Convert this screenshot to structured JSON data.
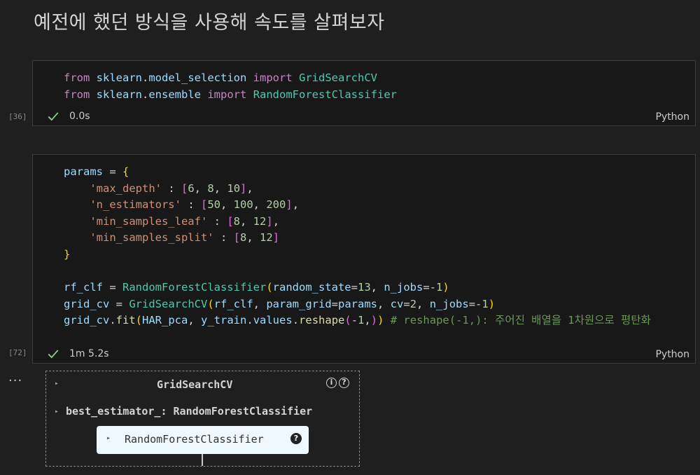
{
  "markdown": {
    "heading": "예전에 했던 방식을 사용해 속도를 살펴보자"
  },
  "cells": [
    {
      "exec_count": "[36]",
      "status_time": "0.0s",
      "language": "Python",
      "lines": [
        [
          [
            "kw",
            "from"
          ],
          [
            "op",
            " "
          ],
          [
            "var",
            "sklearn"
          ],
          [
            "op",
            "."
          ],
          [
            "var",
            "model_selection"
          ],
          [
            "op",
            " "
          ],
          [
            "kw",
            "import"
          ],
          [
            "op",
            " "
          ],
          [
            "cls",
            "GridSearchCV"
          ]
        ],
        [
          [
            "kw",
            "from"
          ],
          [
            "op",
            " "
          ],
          [
            "var",
            "sklearn"
          ],
          [
            "op",
            "."
          ],
          [
            "var",
            "ensemble"
          ],
          [
            "op",
            " "
          ],
          [
            "kw",
            "import"
          ],
          [
            "op",
            " "
          ],
          [
            "cls",
            "RandomForestClassifier"
          ]
        ]
      ]
    },
    {
      "exec_count": "[72]",
      "status_time": "1m 5.2s",
      "language": "Python",
      "lines": [
        [
          [
            "var",
            "params"
          ],
          [
            "op",
            " = "
          ],
          [
            "br1",
            "{"
          ]
        ],
        [
          [
            "op",
            "    "
          ],
          [
            "str",
            "'max_depth'"
          ],
          [
            "op",
            " : "
          ],
          [
            "br2",
            "["
          ],
          [
            "num",
            "6"
          ],
          [
            "op",
            ", "
          ],
          [
            "num",
            "8"
          ],
          [
            "op",
            ", "
          ],
          [
            "num",
            "10"
          ],
          [
            "br2",
            "]"
          ],
          [
            "op",
            ","
          ]
        ],
        [
          [
            "op",
            "    "
          ],
          [
            "str",
            "'n_estimators'"
          ],
          [
            "op",
            " : "
          ],
          [
            "br2",
            "["
          ],
          [
            "num",
            "50"
          ],
          [
            "op",
            ", "
          ],
          [
            "num",
            "100"
          ],
          [
            "op",
            ", "
          ],
          [
            "num",
            "200"
          ],
          [
            "br2",
            "]"
          ],
          [
            "op",
            ","
          ]
        ],
        [
          [
            "op",
            "    "
          ],
          [
            "str",
            "'min_samples_leaf'"
          ],
          [
            "op",
            " : "
          ],
          [
            "br2",
            "["
          ],
          [
            "num",
            "8"
          ],
          [
            "op",
            ", "
          ],
          [
            "num",
            "12"
          ],
          [
            "br2",
            "]"
          ],
          [
            "op",
            ","
          ]
        ],
        [
          [
            "op",
            "    "
          ],
          [
            "str",
            "'min_samples_split'"
          ],
          [
            "op",
            " : "
          ],
          [
            "br2",
            "["
          ],
          [
            "num",
            "8"
          ],
          [
            "op",
            ", "
          ],
          [
            "num",
            "12"
          ],
          [
            "br2",
            "]"
          ]
        ],
        [
          [
            "br1",
            "}"
          ]
        ],
        [
          [
            "op",
            ""
          ]
        ],
        [
          [
            "var",
            "rf_clf"
          ],
          [
            "op",
            " = "
          ],
          [
            "cls",
            "RandomForestClassifier"
          ],
          [
            "br1",
            "("
          ],
          [
            "var",
            "random_state"
          ],
          [
            "op",
            "="
          ],
          [
            "num",
            "13"
          ],
          [
            "op",
            ", "
          ],
          [
            "var",
            "n_jobs"
          ],
          [
            "op",
            "="
          ],
          [
            "op",
            "-"
          ],
          [
            "num",
            "1"
          ],
          [
            "br1",
            ")"
          ]
        ],
        [
          [
            "var",
            "grid_cv"
          ],
          [
            "op",
            " = "
          ],
          [
            "cls",
            "GridSearchCV"
          ],
          [
            "br1",
            "("
          ],
          [
            "var",
            "rf_clf"
          ],
          [
            "op",
            ", "
          ],
          [
            "var",
            "param_grid"
          ],
          [
            "op",
            "="
          ],
          [
            "var",
            "params"
          ],
          [
            "op",
            ", "
          ],
          [
            "var",
            "cv"
          ],
          [
            "op",
            "="
          ],
          [
            "num",
            "2"
          ],
          [
            "op",
            ", "
          ],
          [
            "var",
            "n_jobs"
          ],
          [
            "op",
            "="
          ],
          [
            "op",
            "-"
          ],
          [
            "num",
            "1"
          ],
          [
            "br1",
            ")"
          ]
        ],
        [
          [
            "var",
            "grid_cv"
          ],
          [
            "op",
            "."
          ],
          [
            "fn",
            "fit"
          ],
          [
            "br1",
            "("
          ],
          [
            "var",
            "HAR_pca"
          ],
          [
            "op",
            ", "
          ],
          [
            "var",
            "y_train"
          ],
          [
            "op",
            "."
          ],
          [
            "var",
            "values"
          ],
          [
            "op",
            "."
          ],
          [
            "fn",
            "reshape"
          ],
          [
            "br2",
            "("
          ],
          [
            "op",
            "-"
          ],
          [
            "num",
            "1"
          ],
          [
            "op",
            ","
          ],
          [
            "br2",
            ")"
          ],
          [
            "br1",
            ")"
          ],
          [
            "op",
            " "
          ],
          [
            "cmt",
            "# reshape(-1,): 주어진 배열을 1차원으로 평탄화"
          ]
        ]
      ]
    }
  ],
  "output": {
    "ellipsis": "...",
    "widget_title": "GridSearchCV",
    "info_icon": "i",
    "help_icon": "?",
    "best_estimator_label": "best_estimator_: RandomForestClassifier",
    "estimator_label": "RandomForestClassifier",
    "estimator_help_icon": "?",
    "arrow_glyph": "▸"
  }
}
